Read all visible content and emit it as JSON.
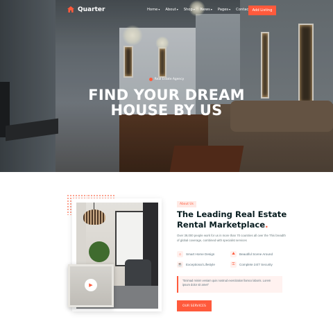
{
  "brand": {
    "name": "Quarter",
    "accent": "#ff5a3c"
  },
  "nav": {
    "items": [
      {
        "label": "Home",
        "has_dropdown": true
      },
      {
        "label": "About",
        "has_dropdown": true
      },
      {
        "label": "Shop",
        "has_dropdown": true
      },
      {
        "label": "News",
        "has_dropdown": true
      },
      {
        "label": "Pages",
        "has_dropdown": true
      },
      {
        "label": "Contact",
        "has_dropdown": false
      }
    ],
    "cta_label": "Add Listing"
  },
  "hero": {
    "tagline": "Real Estate Agency",
    "title_line1": "FIND YOUR DREAM",
    "title_line2": "HOUSE BY US"
  },
  "about": {
    "badge": "About Us",
    "title_line1": "The Leading Real Estate",
    "title_line2": "Rental Marketplace",
    "title_dot": ".",
    "description": "Over 39,000 people work for us in more than 70 countries all over the This breadth of global coverage, combined with specialist services",
    "features": [
      {
        "label": "Smart Home Design",
        "icon": "home-icon"
      },
      {
        "label": "Beautiful Scene Around",
        "icon": "scene-icon"
      },
      {
        "label": "Exceptional Lifestyle",
        "icon": "lifestyle-icon"
      },
      {
        "label": "Complete 24/7 Security",
        "icon": "security-icon"
      }
    ],
    "quote": "\"Enimad minim veniam quis nostrud exercitation llamco laboris. Lorem ipsum dolor sit amet\"",
    "button_label": "OUR SERVICES"
  }
}
